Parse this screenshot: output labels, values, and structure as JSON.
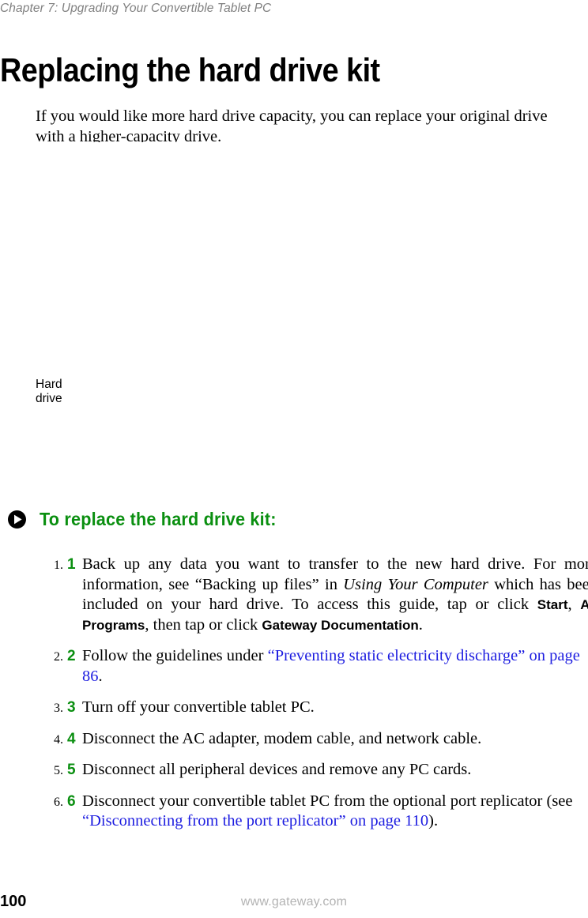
{
  "page": {
    "running_head": "Chapter 7: Upgrading Your Convertible Tablet PC",
    "section_title": "Replacing the hard drive kit",
    "intro_paragraph": "If you would like more hard drive capacity, you can replace your original drive with a higher-capacity drive.",
    "illustration": {
      "callout_label": "Hard\ndrive"
    },
    "procedure": {
      "bullet_icon": "play-triangle-icon",
      "heading": "To replace the hard drive kit:",
      "heading_color": "#0a8f10",
      "steps": [
        {
          "number": "1",
          "segments": [
            {
              "type": "text",
              "text": "Back up any data you want to transfer to the new hard drive. For more information, see “Backing up files” in "
            },
            {
              "type": "italic",
              "text": "Using Your Computer"
            },
            {
              "type": "text",
              "text": " which has been included on your hard drive. To access this guide, tap or click "
            },
            {
              "type": "ui",
              "text": "Start"
            },
            {
              "type": "text",
              "text": ", "
            },
            {
              "type": "ui",
              "text": "All Programs"
            },
            {
              "type": "text",
              "text": ", then tap or click "
            },
            {
              "type": "ui",
              "text": "Gateway Documentation"
            },
            {
              "type": "text",
              "text": "."
            }
          ]
        },
        {
          "number": "2",
          "segments": [
            {
              "type": "text",
              "text": "Follow the guidelines under "
            },
            {
              "type": "xref",
              "text": "“Preventing static electricity discharge” on page 86"
            },
            {
              "type": "text",
              "text": "."
            }
          ]
        },
        {
          "number": "3",
          "segments": [
            {
              "type": "text",
              "text": "Turn off your convertible tablet PC."
            }
          ]
        },
        {
          "number": "4",
          "segments": [
            {
              "type": "text",
              "text": "Disconnect the AC adapter, modem cable, and network cable."
            }
          ]
        },
        {
          "number": "5",
          "segments": [
            {
              "type": "text",
              "text": "Disconnect all peripheral devices and remove any PC cards."
            }
          ]
        },
        {
          "number": "6",
          "segments": [
            {
              "type": "text",
              "text": "Disconnect your convertible tablet PC from the optional port replicator (see "
            },
            {
              "type": "xref",
              "text": "“Disconnecting from the port replicator” on page 110"
            },
            {
              "type": "text",
              "text": ")."
            }
          ]
        }
      ]
    },
    "footer": {
      "page_number": "100",
      "url": "www.gateway.com"
    },
    "colors": {
      "accent_green": "#0a8f10",
      "link_blue": "#1c1ce0",
      "running_head_gray": "#808080",
      "footer_url_gray": "#b3b3b3"
    }
  }
}
